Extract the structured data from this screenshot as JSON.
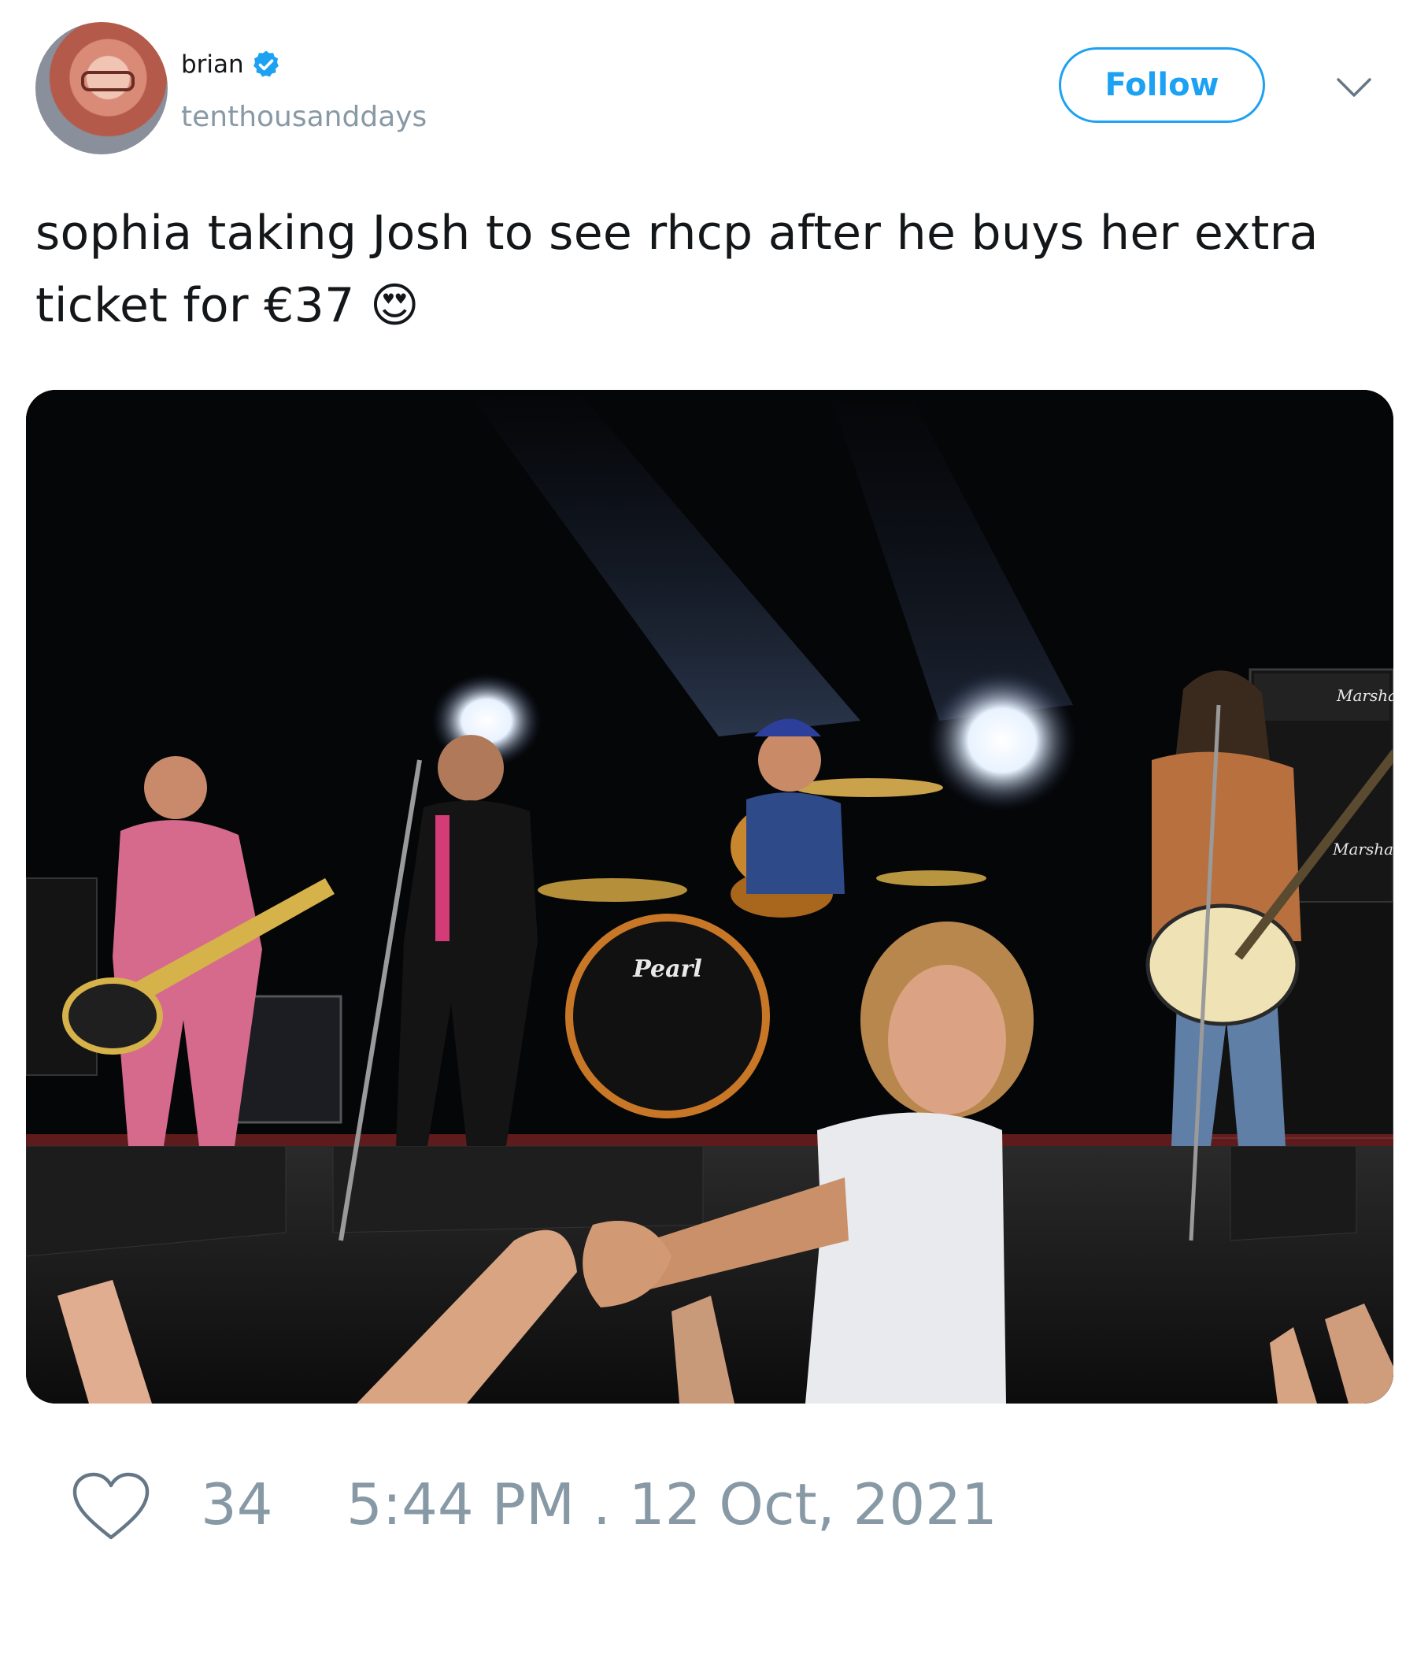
{
  "user": {
    "display_name": "brian",
    "handle": "tenthousanddays",
    "verified": true,
    "verified_color": "#1da1f2"
  },
  "follow_button": {
    "label": "Follow",
    "color": "#1da1f2"
  },
  "tweet": {
    "text": "sophia taking Josh to see rhcp after he buys her extra ticket for €37 😍"
  },
  "photo": {
    "drum_brand": "Pearl",
    "amp_brand": "Marshall"
  },
  "footer": {
    "like_count": "34",
    "timestamp": "5:44 PM . 12 Oct, 2021"
  },
  "icons": {
    "verified": "verified-badge-icon",
    "chevron": "chevron-down-icon",
    "heart": "heart-icon"
  }
}
